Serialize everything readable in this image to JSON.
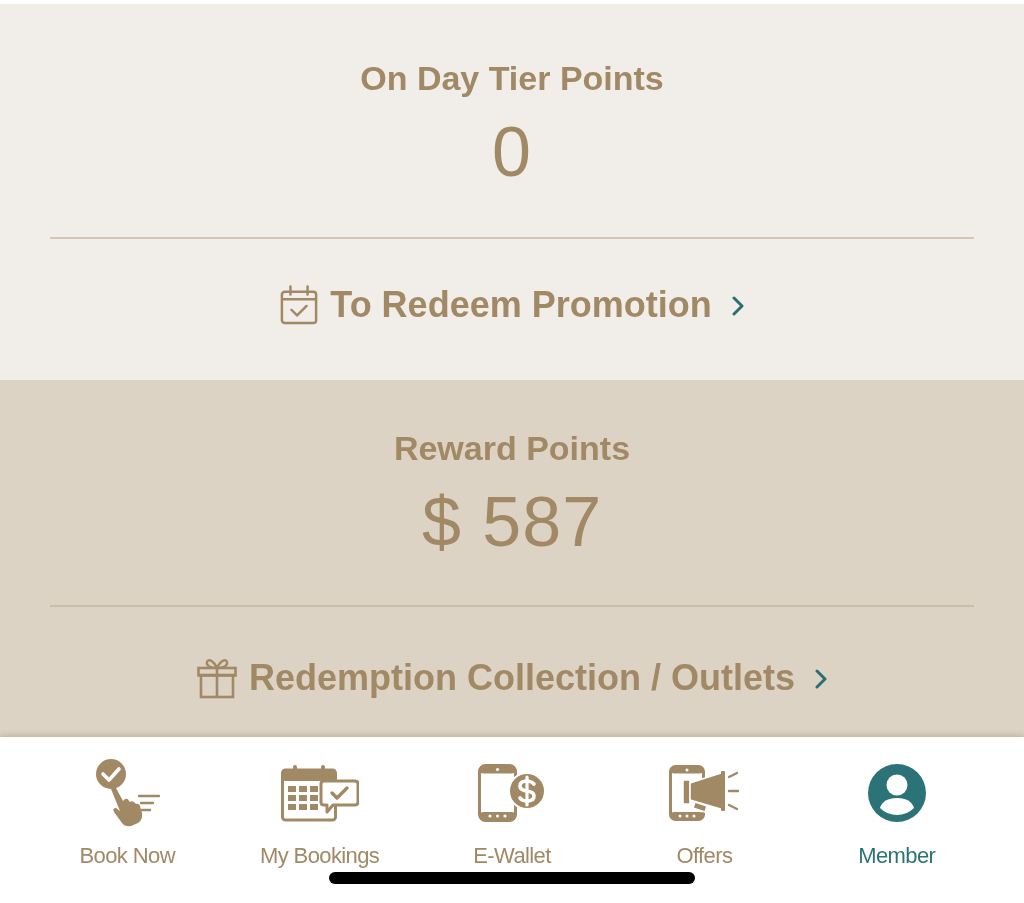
{
  "sections": [
    {
      "title": "On Day Tier Points",
      "value": "0",
      "link": "To Redeem Promotion"
    },
    {
      "title": "Reward Points",
      "value": "$ 587",
      "link": "Redemption Collection / Outlets"
    }
  ],
  "tab_bar": [
    {
      "label": "Book Now",
      "selected": false
    },
    {
      "label": "My Bookings",
      "selected": false
    },
    {
      "label": "E-Wallet",
      "selected": false
    },
    {
      "label": "Offers",
      "selected": false
    },
    {
      "label": "Member",
      "selected": true
    }
  ]
}
